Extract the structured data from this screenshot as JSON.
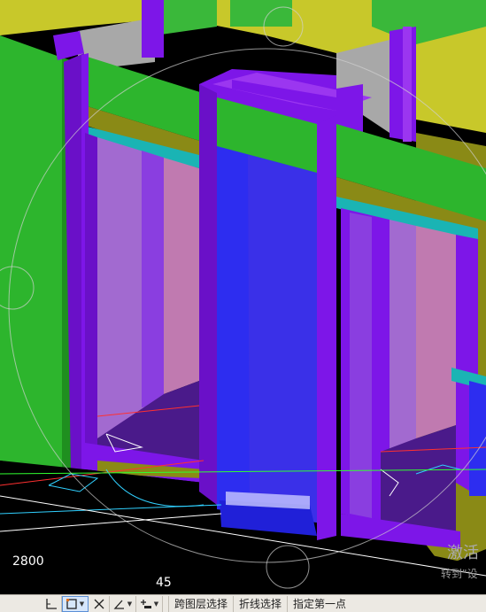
{
  "viewport": {
    "dimension_label": "2800",
    "number_label": "45",
    "watermark_line1": "激活",
    "watermark_line2": "转到\"设"
  },
  "statusbar": {
    "buttons": [
      {
        "name": "ortho-mode-icon",
        "type": "icon"
      },
      {
        "name": "select-box-icon",
        "type": "icon-dropdown",
        "active": true
      },
      {
        "name": "cross-select-icon",
        "type": "icon"
      },
      {
        "name": "angle-tool-icon",
        "type": "icon-dropdown"
      },
      {
        "name": "point-add-icon",
        "type": "icon-dropdown"
      }
    ],
    "cross_layer_select": "跨图层选择",
    "polyline_select": "折线选择",
    "prompt": "指定第一点"
  },
  "colors": {
    "background": "#000000",
    "wall_green": "#2db52d",
    "column_purple": "#7d16e8",
    "column_blue": "#2d2df0",
    "ceiling_yellow": "#c8c82a",
    "cyan_band": "#1ab4b4",
    "olive": "#8a8a16",
    "room_pink": "#c07ab0"
  }
}
